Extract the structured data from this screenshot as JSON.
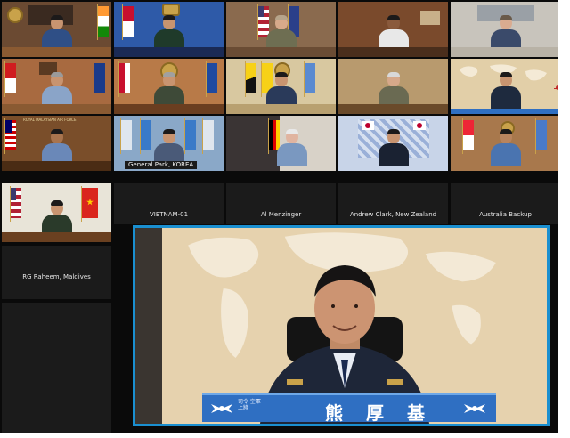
{
  "colors": {
    "spotlight_border": "#1a8fd0",
    "highlight": "#c0282a",
    "nameplate": "#2f6fc2"
  },
  "grid": {
    "tiles": [
      {
        "name_label": ""
      },
      {
        "name_label": ""
      },
      {
        "name_label": ""
      },
      {
        "name_label": ""
      },
      {
        "name_label": ""
      },
      {
        "name_label": ""
      },
      {
        "name_label": ""
      },
      {
        "name_label": ""
      },
      {
        "name_label": ""
      },
      {
        "name_label": ""
      },
      {
        "name_label": ""
      },
      {
        "name_label": "General Park, KOREA"
      },
      {
        "name_label": ""
      },
      {
        "name_label": ""
      },
      {
        "name_label": ""
      },
      {
        "name_label": "RG Raheem, Maldives"
      },
      {
        "name_label": "VIETNAM-01"
      },
      {
        "name_label": "Al Menzinger"
      },
      {
        "name_label": "Andrew Clark, New Zealand"
      },
      {
        "name_label": "Australia Backup"
      }
    ],
    "banner_small": "ROYAL MALAYSIAN AIR FORCE"
  },
  "spotlight": {
    "nameplate_chars": [
      "熊",
      "厚",
      "基"
    ],
    "nameplate_caption": "司令 空軍上將"
  }
}
